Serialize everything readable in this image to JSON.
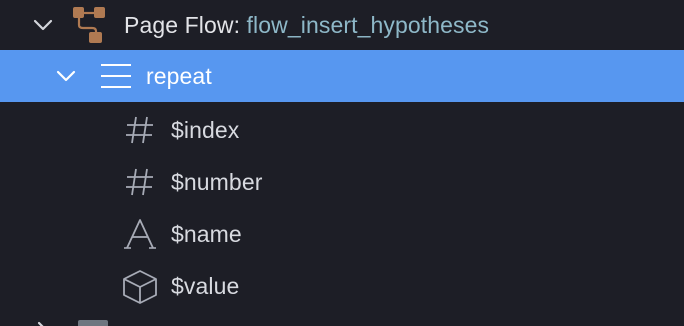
{
  "tree": {
    "root": {
      "prefix": "Page Flow: ",
      "name": "flow_insert_hypotheses",
      "expanded": true,
      "icon": "flow-graph-icon",
      "icon_color": "#b07a52"
    },
    "repeat": {
      "label": "repeat",
      "expanded": true,
      "selected": true,
      "icon": "list-lines-icon",
      "highlight_color": "#5797f0"
    },
    "variables": [
      {
        "label": "$index",
        "icon": "hash-icon",
        "glyph": "#"
      },
      {
        "label": "$number",
        "icon": "hash-icon",
        "glyph": "#"
      },
      {
        "label": "$name",
        "icon": "text-type-icon",
        "glyph": "A"
      },
      {
        "label": "$value",
        "icon": "cube-icon"
      }
    ]
  },
  "colors": {
    "background": "#1d1e26",
    "text": "#d8dae0",
    "root_value": "#8eb8c8",
    "icon": "#a7abb6"
  }
}
